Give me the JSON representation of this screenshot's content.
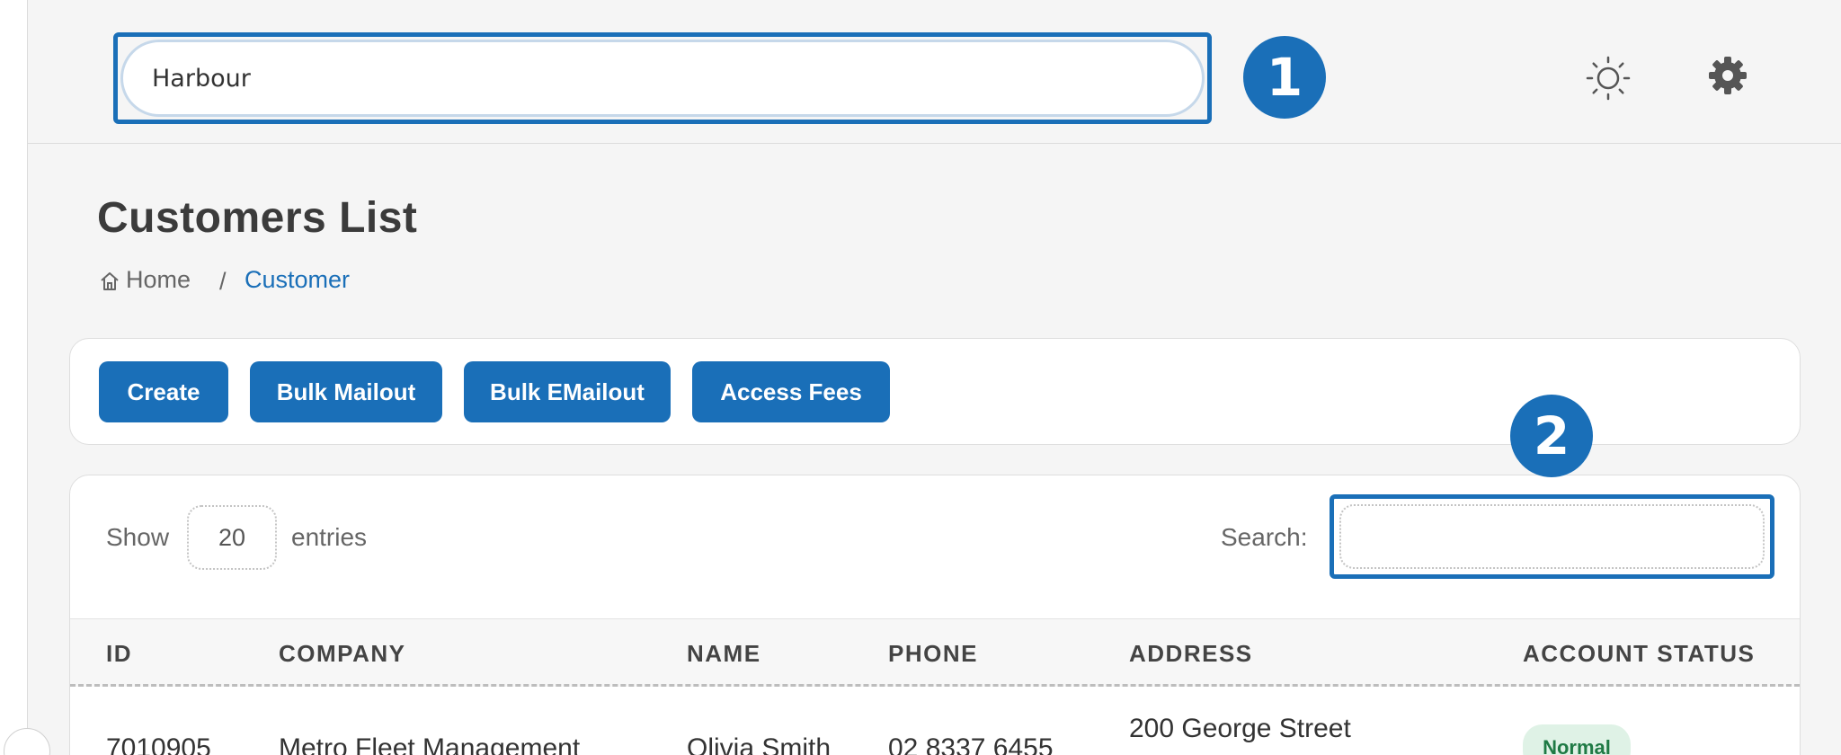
{
  "header": {
    "global_search_value": "Harbour",
    "annotation_1": "1",
    "theme_toggle_icon": "sun-icon",
    "settings_icon": "gear-icon"
  },
  "page": {
    "title": "Customers List",
    "breadcrumb": {
      "home": "Home",
      "separator": "/",
      "current": "Customer"
    }
  },
  "toolbar": {
    "create_label": "Create",
    "bulk_mailout_label": "Bulk Mailout",
    "bulk_emailout_label": "Bulk EMailout",
    "access_fees_label": "Access Fees"
  },
  "table_controls": {
    "show_label": "Show",
    "entries_value": "20",
    "entries_label": "entries",
    "search_label": "Search:",
    "search_value": "",
    "annotation_2": "2"
  },
  "table": {
    "columns": [
      "ID",
      "COMPANY",
      "NAME",
      "PHONE",
      "ADDRESS",
      "ACCOUNT STATUS"
    ],
    "rows": [
      {
        "id": "7010905",
        "company": "Metro Fleet Management",
        "name": "Olivia Smith",
        "phone": "02 8337 6455",
        "address": "200 George Street",
        "status": "Normal"
      }
    ]
  },
  "colors": {
    "accent": "#1a6fb8",
    "status_normal_bg": "#dff2e6",
    "status_normal_text": "#1f7a45"
  }
}
